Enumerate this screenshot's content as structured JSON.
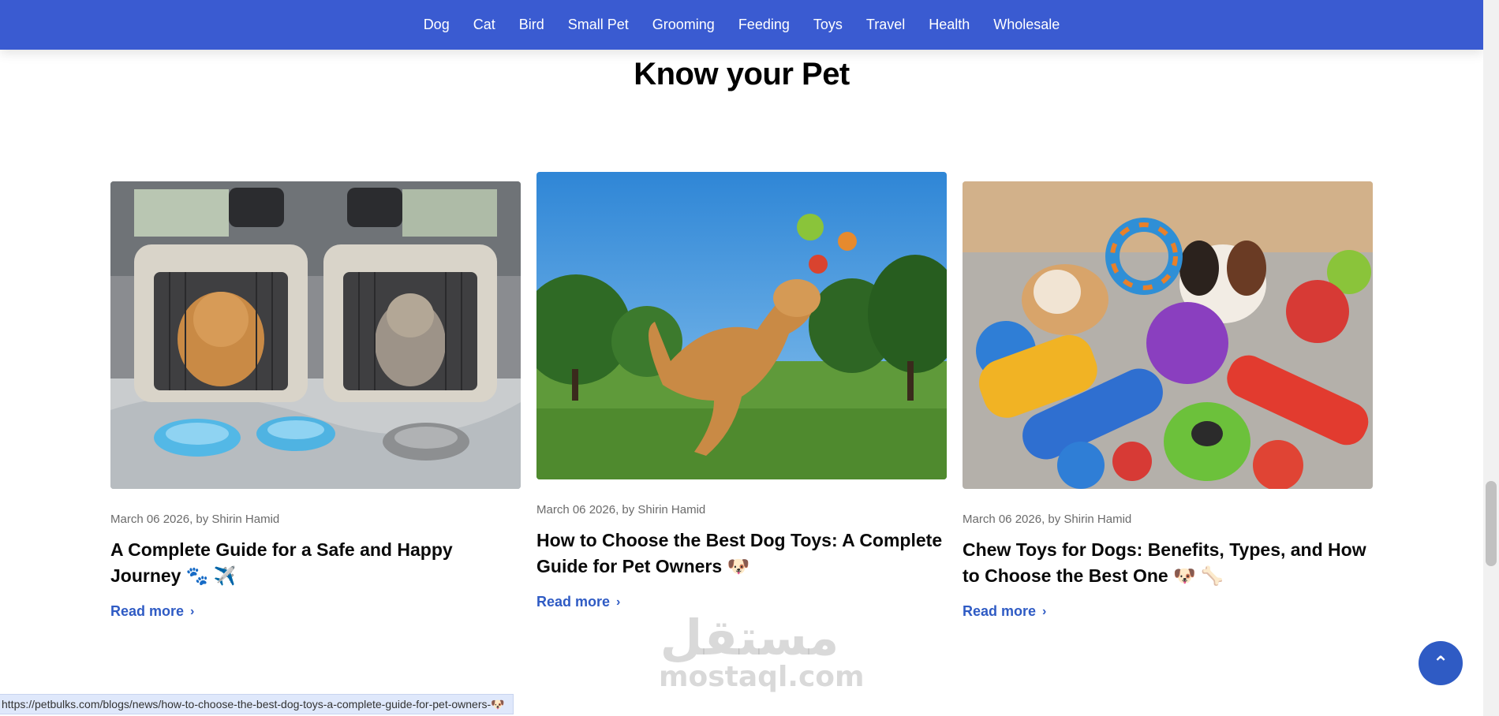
{
  "nav": {
    "items": [
      "Dog",
      "Cat",
      "Bird",
      "Small Pet",
      "Grooming",
      "Feeding",
      "Toys",
      "Travel",
      "Health",
      "Wholesale"
    ]
  },
  "section": {
    "title": "Know your Pet"
  },
  "cards": [
    {
      "meta": "March 06 2026, by Shirin Hamid",
      "title": "A Complete Guide for a Safe and Happy Journey 🐾 ✈️",
      "read_more": "Read more"
    },
    {
      "meta": "March 06 2026, by Shirin Hamid",
      "title": "How to Choose the Best Dog Toys: A Complete Guide for Pet Owners 🐶",
      "read_more": "Read more"
    },
    {
      "meta": "March 06 2026, by Shirin Hamid",
      "title": "Chew Toys for Dogs: Benefits, Types, and How to Choose the Best One 🐶 🦴",
      "read_more": "Read more"
    }
  ],
  "watermark": {
    "arabic": "مستقل",
    "latin": "mostaql.com"
  },
  "back_to_top": {
    "icon": "chevron-up-icon"
  },
  "status_url": "https://petbulks.com/blogs/news/how-to-choose-the-best-dog-toys-a-complete-guide-for-pet-owners-🐶",
  "colors": {
    "nav_bg": "#3a5bd1",
    "link": "#2f5bc4",
    "button": "#2f5bc4"
  }
}
